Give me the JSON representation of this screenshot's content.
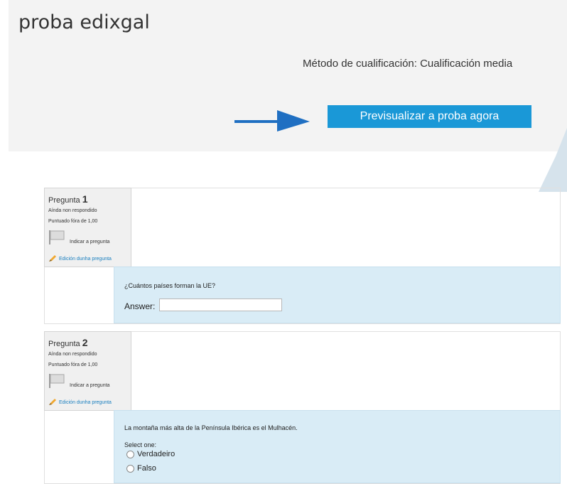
{
  "quiz": {
    "title": "proba edixgal",
    "grading_method": "Método de cualificación: Cualificación media",
    "preview_button": "Previsualizar a proba agora"
  },
  "colors": {
    "accent": "#1a98d7",
    "arrow": "#1f6fc2",
    "formulation_bg": "#d9ecf6",
    "info_bg": "#f0f0f0",
    "link": "#1a7fbf"
  },
  "questions": [
    {
      "label": "Pregunta",
      "number": "1",
      "state": "Aínda non respondido",
      "grade": "Puntuado fóra de 1,00",
      "flag_label": "Indicar a pregunta",
      "edit_label": "Edición dunha pregunta",
      "text": "¿Cuántos países forman la UE?",
      "answer_label": "Answer:",
      "answer_value": ""
    },
    {
      "label": "Pregunta",
      "number": "2",
      "state": "Aínda non respondido",
      "grade": "Puntuado fóra de 1,00",
      "flag_label": "Indicar a pregunta",
      "edit_label": "Edición dunha pregunta",
      "text": "La montaña más alta de la Península Ibérica es el Mulhacén.",
      "select_label": "Select one:",
      "options": [
        "Verdadeiro",
        "Falso"
      ]
    }
  ],
  "icons": {
    "arrow": "arrow-right-icon",
    "flag": "flag-icon",
    "edit": "pencil-icon",
    "radio": "radio-icon"
  }
}
